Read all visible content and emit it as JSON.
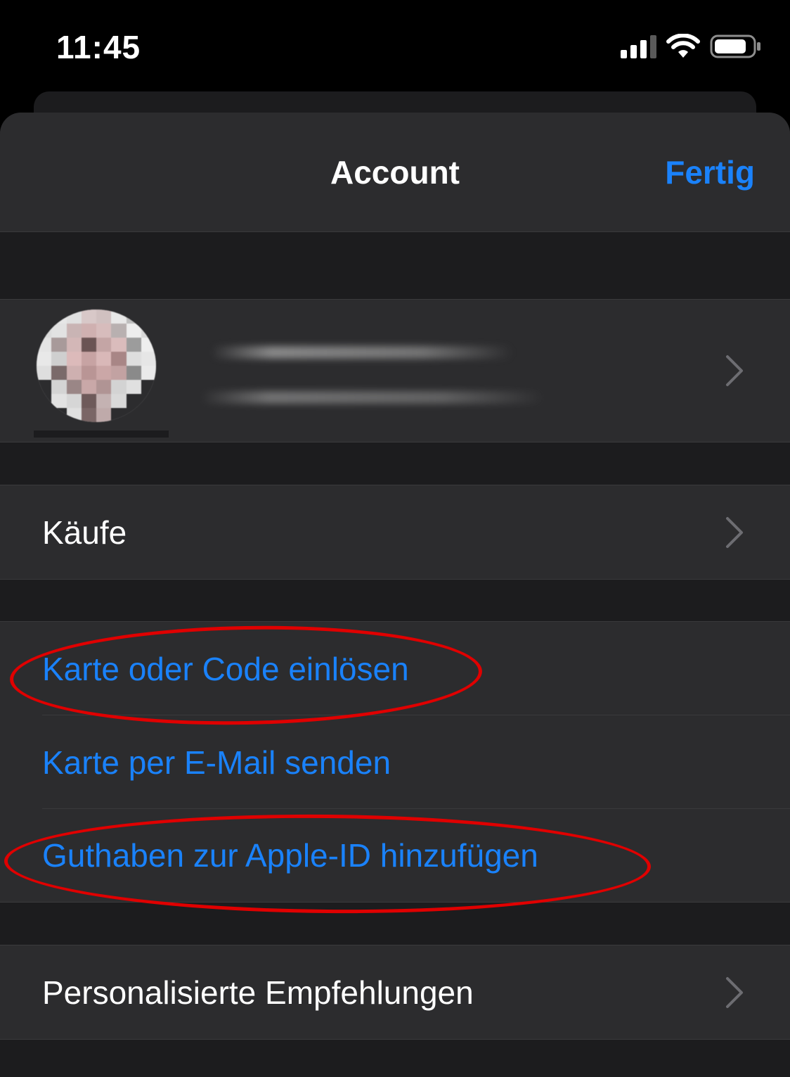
{
  "status_bar": {
    "time": "11:45",
    "icons": [
      "cellular-signal-icon",
      "wifi-icon",
      "battery-icon"
    ]
  },
  "nav": {
    "title": "Account",
    "done_label": "Fertig"
  },
  "profile": {
    "avatar_icon": "avatar-pixelated",
    "name_redacted": true
  },
  "rows": {
    "purchases": "Käufe",
    "redeem": "Karte oder Code einlösen",
    "send_gift": "Karte per E-Mail senden",
    "add_funds": "Guthaben zur Apple-ID hinzufügen",
    "recommendations": "Personalisierte Empfehlungen"
  },
  "annotations": {
    "color": "#e00000",
    "highlighted_rows": [
      "Karte oder Code einlösen",
      "Guthaben zur Apple-ID hinzufügen"
    ]
  },
  "colors": {
    "accent": "#1a82fb",
    "background": "#1c1c1e",
    "cell": "#2c2c2e",
    "separator": "#3a3a3c"
  }
}
